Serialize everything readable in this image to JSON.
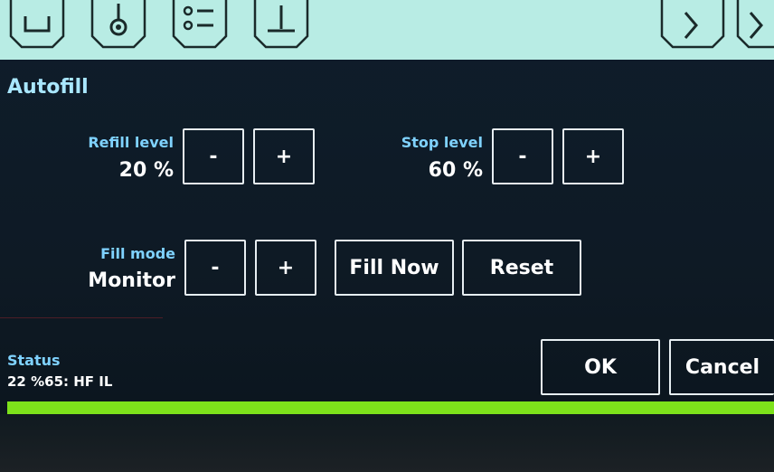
{
  "app": {
    "title": "Autofill"
  },
  "top_icons": [
    {
      "name": "box-icon"
    },
    {
      "name": "thermometer-icon"
    },
    {
      "name": "list-icon"
    },
    {
      "name": "baseline-icon"
    },
    {
      "name": "chevron-left-icon"
    },
    {
      "name": "chevron-right-icon"
    }
  ],
  "refill": {
    "label": "Refill level",
    "value": "20 %",
    "minus": "-",
    "plus": "+"
  },
  "stop": {
    "label": "Stop level",
    "value": "60 %",
    "minus": "-",
    "plus": "+"
  },
  "fill_mode": {
    "label": "Fill mode",
    "value": "Monitor",
    "minus": "-",
    "plus": "+"
  },
  "actions": {
    "fill_now": "Fill Now",
    "reset": "Reset"
  },
  "status": {
    "label": "Status",
    "value": "22 %65: HF IL",
    "progress_percent": 100
  },
  "dialog": {
    "ok": "OK",
    "cancel": "Cancel"
  },
  "colors": {
    "accent_label": "#7fd2ff",
    "progress": "#7de21b",
    "top_bar": "#b8ece4"
  }
}
